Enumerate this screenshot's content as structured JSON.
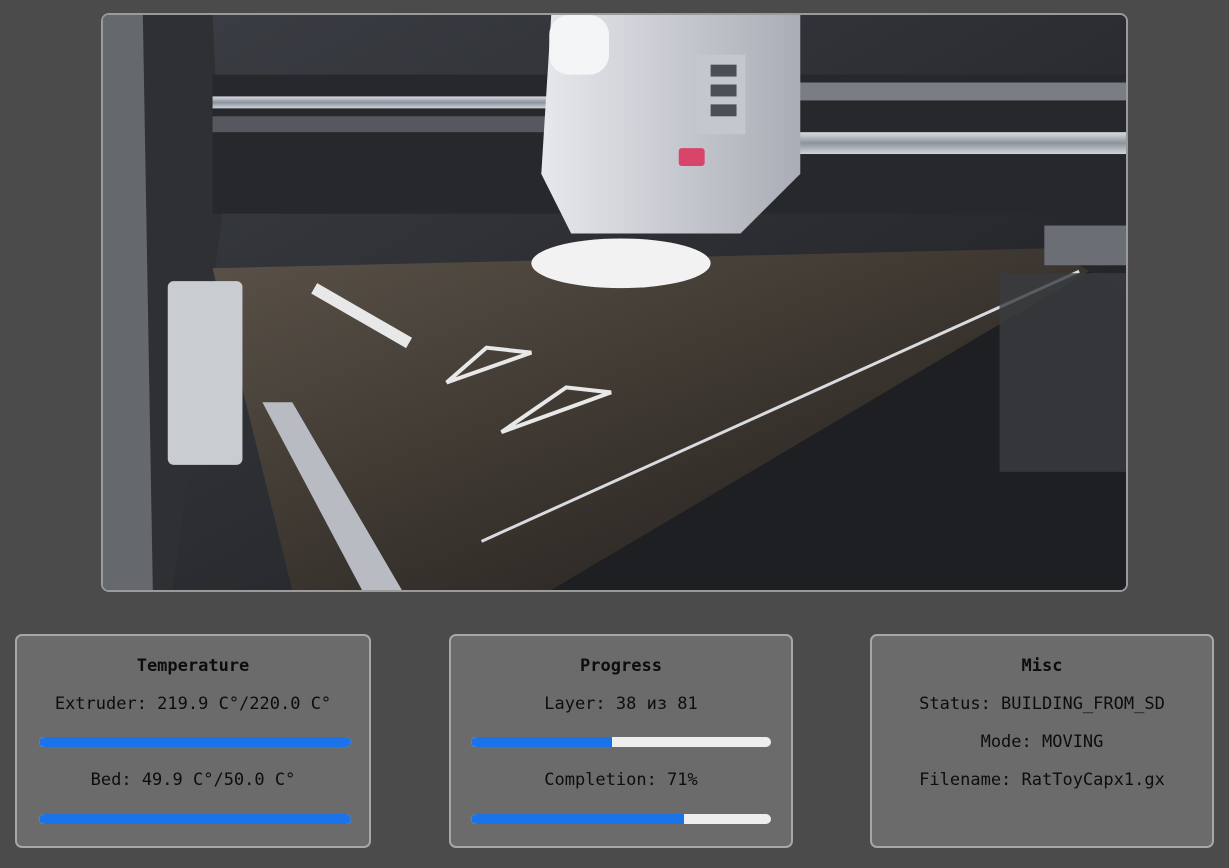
{
  "colors": {
    "page_background": "#4b4b4b",
    "panel_background": "#6b6b6b",
    "panel_border": "#a7a7a7",
    "progress_fill": "#1a73e8",
    "progress_track": "#eeeeee"
  },
  "camera": {
    "feed": "printer-webcam-image"
  },
  "temperature": {
    "title": "Temperature",
    "extruder_label": "Extruder: 219.9 C°/220.0 C°",
    "extruder_fill": 1.0,
    "bed_label": "Bed: 49.9 C°/50.0 C°",
    "bed_fill": 1.0
  },
  "progress": {
    "title": "Progress",
    "layer_label": "Layer: 38 из 81",
    "layer_fill": 0.469,
    "completion_label": "Completion: 71%",
    "completion_fill": 0.71
  },
  "misc": {
    "title": "Misc",
    "status_label": "Status: BUILDING_FROM_SD",
    "mode_label": "Mode: MOVING",
    "filename_label": "Filename: RatToyCapx1.gx"
  }
}
